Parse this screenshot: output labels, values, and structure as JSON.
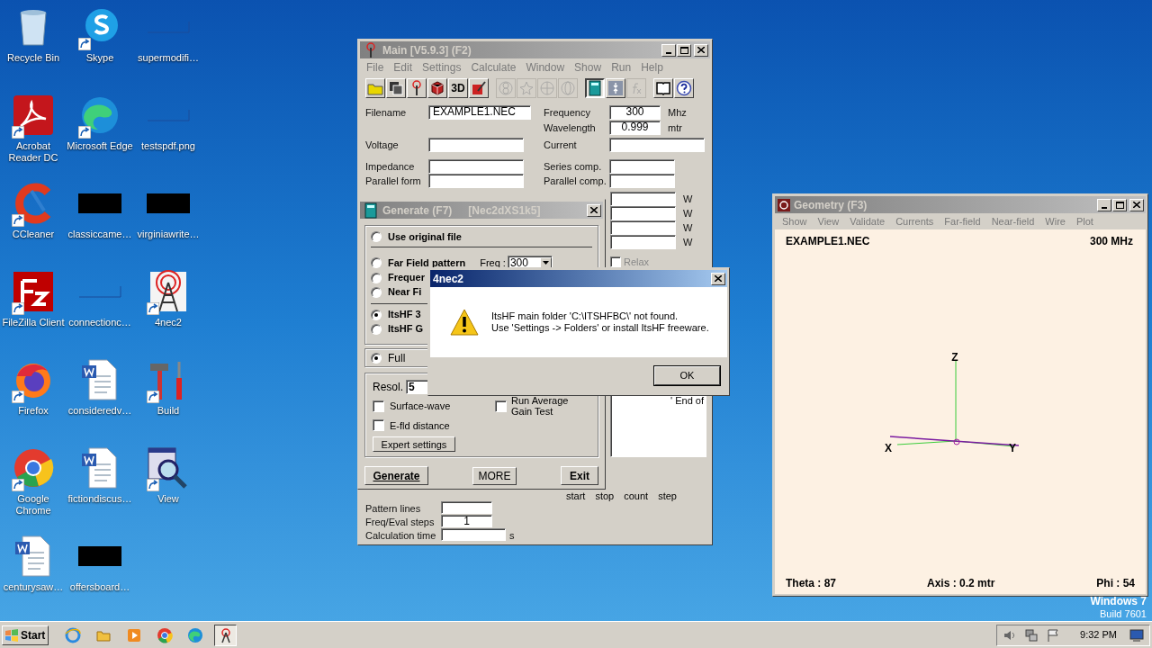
{
  "desktop": {
    "icons": [
      {
        "label": "Recycle Bin",
        "kind": "recycle",
        "shortcut": false
      },
      {
        "label": "Skype",
        "kind": "skype",
        "shortcut": true
      },
      {
        "label": "supermodifi…",
        "kind": "blank",
        "shortcut": false
      },
      {
        "label": "Acrobat Reader DC",
        "kind": "acrobat",
        "shortcut": true
      },
      {
        "label": "Microsoft Edge",
        "kind": "edge",
        "shortcut": true
      },
      {
        "label": "testspdf.png",
        "kind": "blank",
        "shortcut": false
      },
      {
        "label": "CCleaner",
        "kind": "ccleaner",
        "shortcut": true
      },
      {
        "label": "classiccame…",
        "kind": "redacted",
        "shortcut": false
      },
      {
        "label": "virginiawrite…",
        "kind": "redacted",
        "shortcut": false
      },
      {
        "label": "FileZilla Client",
        "kind": "filezilla",
        "shortcut": true
      },
      {
        "label": "connectionc…",
        "kind": "blank",
        "shortcut": false
      },
      {
        "label": "4nec2",
        "kind": "tower",
        "shortcut": true
      },
      {
        "label": "Firefox",
        "kind": "firefox",
        "shortcut": true
      },
      {
        "label": "consideredv…",
        "kind": "word",
        "shortcut": false
      },
      {
        "label": "Build",
        "kind": "tools",
        "shortcut": true
      },
      {
        "label": "Google Chrome",
        "kind": "chrome",
        "shortcut": true
      },
      {
        "label": "fictiondiscus…",
        "kind": "word",
        "shortcut": false
      },
      {
        "label": "View",
        "kind": "magnifier",
        "shortcut": true
      },
      {
        "label": "centurysaw…",
        "kind": "word",
        "shortcut": false
      },
      {
        "label": "offersboard…",
        "kind": "redacted",
        "shortcut": false
      }
    ],
    "branding": [
      "Windows 7",
      "Build 7601"
    ]
  },
  "main_window": {
    "title": "Main [V5.9.3]   (F2)",
    "menu": [
      "File",
      "Edit",
      "Settings",
      "Calculate",
      "Window",
      "Show",
      "Run",
      "Help"
    ],
    "toolbar_groups": [
      {
        "buttons": [
          {
            "kind": "folder",
            "disabled": false,
            "pressed": false
          },
          {
            "kind": "disks",
            "disabled": false,
            "pressed": false
          },
          {
            "kind": "antenna",
            "disabled": false,
            "pressed": false
          },
          {
            "kind": "cube",
            "disabled": false,
            "pressed": false
          },
          {
            "kind": "text",
            "label": "3D",
            "disabled": false,
            "pressed": false
          },
          {
            "kind": "pencil",
            "disabled": false,
            "pressed": false
          }
        ]
      },
      {
        "buttons": [
          {
            "kind": "rings",
            "disabled": true,
            "pressed": false
          },
          {
            "kind": "star",
            "disabled": true,
            "pressed": false
          },
          {
            "kind": "sphere",
            "disabled": true,
            "pressed": false
          },
          {
            "kind": "globe",
            "disabled": true,
            "pressed": false
          }
        ]
      },
      {
        "buttons": [
          {
            "kind": "calculator",
            "disabled": false,
            "pressed": true
          },
          {
            "kind": "arrows",
            "disabled": false,
            "pressed": false
          },
          {
            "kind": "fx",
            "disabled": true,
            "pressed": false
          }
        ]
      },
      {
        "buttons": [
          {
            "kind": "book",
            "disabled": false,
            "pressed": false
          },
          {
            "kind": "help",
            "disabled": false,
            "pressed": false
          }
        ]
      }
    ],
    "filename": {
      "label": "Filename",
      "value": "EXAMPLE1.NEC"
    },
    "frequency": {
      "label": "Frequency",
      "value": "300",
      "unit": "Mhz"
    },
    "wavelength": {
      "label": "Wavelength",
      "value": "0.999",
      "unit": "mtr"
    },
    "voltage": {
      "label": "Voltage"
    },
    "current": {
      "label": "Current"
    },
    "impedance": {
      "label": "Impedance"
    },
    "series_comp": {
      "label": "Series comp."
    },
    "parallel_form": {
      "label": "Parallel form"
    },
    "parallel_comp": {
      "label": "Parallel comp."
    },
    "power_rows": [
      {
        "unit": "W"
      },
      {
        "unit": "W"
      },
      {
        "unit": "W"
      },
      {
        "unit": "W"
      }
    ],
    "relax": {
      "label": "Relax",
      "checked": false
    },
    "output_text": "' End of",
    "sweep_headers": [
      "start",
      "stop",
      "count",
      "step"
    ],
    "pattern_lines": {
      "label": "Pattern lines"
    },
    "freq_eval_steps": {
      "label": "Freq/Eval steps",
      "value": "1"
    },
    "calculation_time": {
      "label": "Calculation time",
      "unit": "s"
    }
  },
  "generate_window": {
    "title": "Generate (F7)",
    "engine": "[Nec2dXS1k5]",
    "options": [
      {
        "label": "Use original file",
        "selected": false
      },
      {
        "label": "Far Field pattern",
        "selected": false
      },
      {
        "label": "Frequer",
        "selected": false
      },
      {
        "label": "Near Fi",
        "selected": false
      },
      {
        "label": "ItsHF 3",
        "selected": true
      },
      {
        "label": "ItsHF G",
        "selected": false
      }
    ],
    "freq": {
      "label": "Freq :",
      "value": "300"
    },
    "full": {
      "label": "Full",
      "selected": true
    },
    "resolution": {
      "label": "Resol.",
      "value": "5"
    },
    "checkboxes": [
      {
        "label": "Surface-wave",
        "checked": false
      },
      {
        "label": "E-fld distance",
        "checked": false
      },
      {
        "label": "Run Average Gain Test",
        "checked": false
      }
    ],
    "expert_button": "Expert settings",
    "buttons": [
      "Generate",
      "MORE",
      "Exit"
    ]
  },
  "dialog": {
    "title": "4nec2",
    "lines": [
      "ItsHF main folder 'C:\\ITSHFBC\\' not found.",
      "Use 'Settings -> Folders' or install ItsHF freeware."
    ],
    "button": "OK"
  },
  "geometry_window": {
    "title": "Geometry   (F3)",
    "menu": [
      "Show",
      "View",
      "Validate",
      "Currents",
      "Far-field",
      "Near-field",
      "Wire",
      "Plot"
    ],
    "filename": "EXAMPLE1.NEC",
    "frequency": "300 MHz",
    "axes": [
      "Z",
      "X",
      "Y"
    ],
    "theta": "Theta : 87",
    "axis": "Axis : 0.2 mtr",
    "phi": "Phi : 54"
  },
  "taskbar": {
    "start": "Start",
    "apps": [
      {
        "kind": "ie",
        "selected": false
      },
      {
        "kind": "folder",
        "selected": false
      },
      {
        "kind": "media",
        "selected": false
      },
      {
        "kind": "chrome",
        "selected": false
      },
      {
        "kind": "edge",
        "selected": false
      },
      {
        "kind": "tower",
        "selected": true
      }
    ],
    "clock": "9:32 PM"
  }
}
